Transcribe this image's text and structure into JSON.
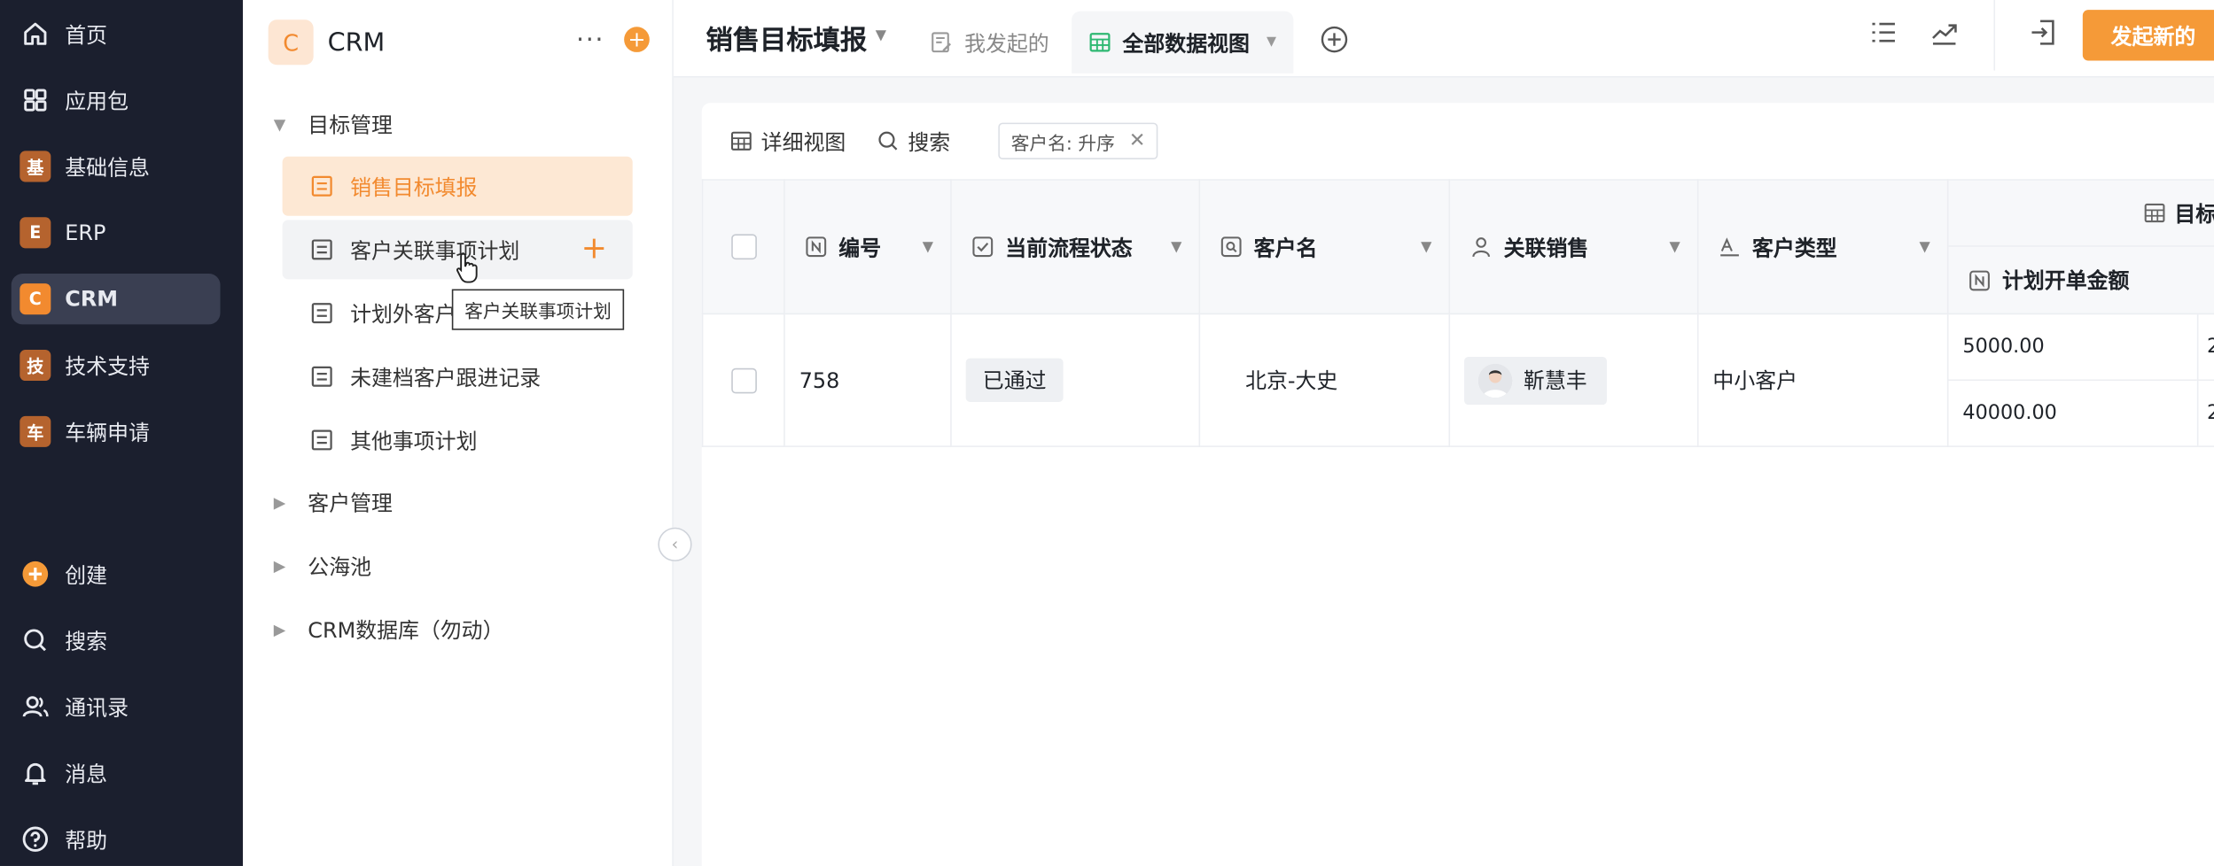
{
  "nav": {
    "items": [
      {
        "label": "首页",
        "icon": "home-icon"
      },
      {
        "label": "应用包",
        "icon": "grid-icon"
      },
      {
        "label": "基础信息",
        "badge": "基"
      },
      {
        "label": "ERP",
        "badge": "E"
      },
      {
        "label": "CRM",
        "badge": "C"
      },
      {
        "label": "技术支持",
        "badge": "技"
      },
      {
        "label": "车辆申请",
        "badge": "车"
      }
    ],
    "bottom": [
      {
        "label": "创建",
        "icon": "plus-circle-icon"
      },
      {
        "label": "搜索",
        "icon": "search-icon"
      },
      {
        "label": "通讯录",
        "icon": "contacts-icon"
      },
      {
        "label": "消息",
        "icon": "bell-icon"
      },
      {
        "label": "帮助",
        "icon": "help-icon"
      }
    ]
  },
  "sidebar": {
    "app_icon": "C",
    "app_name": "CRM",
    "more": "···",
    "add": "+",
    "groups": [
      "目标管理",
      "客户管理",
      "公海池",
      "CRM数据库（勿动）"
    ],
    "menu": [
      "销售目标填报",
      "客户关联事项计划",
      "计划外客户",
      "未建档客户跟进记录",
      "其他事项计划"
    ],
    "tooltip": "客户关联事项计划"
  },
  "topbar": {
    "title": "销售目标填报",
    "tabs": [
      {
        "label": "我发起的"
      },
      {
        "label": "全部数据视图"
      }
    ],
    "primary_button": "发起新的"
  },
  "toolbar": {
    "detail_view": "详细视图",
    "search": "搜索",
    "sort_chip": "客户名: 升序"
  },
  "table": {
    "columns": [
      "编号",
      "当前流程状态",
      "客户名",
      "关联销售",
      "客户类型"
    ],
    "group_header": "目标",
    "sub_column": "计划开单金额",
    "rows": [
      {
        "id": "758",
        "status": "已通过",
        "customer": "北京-大史",
        "sales": "靳慧丰",
        "type": "中小客户",
        "amounts": [
          "5000.00",
          "40000.00"
        ],
        "overflow": [
          "2",
          "2"
        ]
      }
    ]
  },
  "colors": {
    "accent": "#f59a38",
    "nav_bg": "#1b1f2e",
    "active_menu_bg": "#fde8d4"
  }
}
